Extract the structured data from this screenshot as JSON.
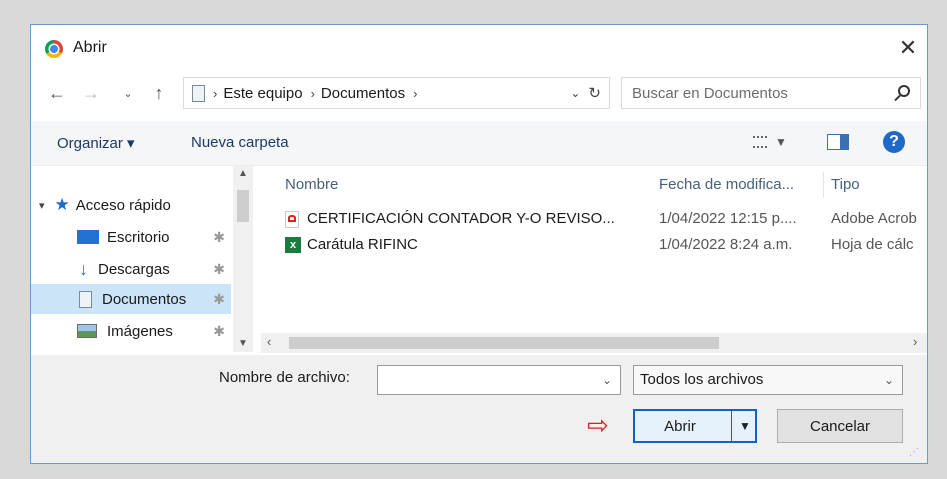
{
  "window": {
    "title": "Abrir"
  },
  "address": {
    "crumbs": [
      "Este equipo",
      "Documentos"
    ]
  },
  "search": {
    "placeholder": "Buscar en Documentos"
  },
  "toolbar": {
    "organize_label": "Organizar ▾",
    "new_folder_label": "Nueva carpeta"
  },
  "sidebar": {
    "items": [
      {
        "label": "Acceso rápido",
        "icon": "star-icon"
      },
      {
        "label": "Escritorio",
        "icon": "desktop-icon"
      },
      {
        "label": "Descargas",
        "icon": "download-icon"
      },
      {
        "label": "Documentos",
        "icon": "document-icon",
        "selected": true
      },
      {
        "label": "Imágenes",
        "icon": "image-icon"
      }
    ]
  },
  "files": {
    "columns": [
      "Nombre",
      "Fecha de modifica...",
      "Tipo"
    ],
    "rows": [
      {
        "name": "CERTIFICACIÓN CONTADOR Y-O REVISO...",
        "date": "1/04/2022 12:15 p....",
        "type": "Adobe Acrob",
        "icon": "pdf-icon"
      },
      {
        "name": "Carátula RIFINC",
        "date": "1/04/2022 8:24 a.m.",
        "type": "Hoja de cálc",
        "icon": "excel-icon"
      }
    ]
  },
  "footer": {
    "filename_label": "Nombre de archivo:",
    "filename_value": "",
    "filter_value": "Todos los archivos",
    "open_label": "Abrir",
    "cancel_label": "Cancelar"
  },
  "colors": {
    "accent": "#1e68c8",
    "arrow": "#d92020",
    "selection": "#cce4f7"
  }
}
